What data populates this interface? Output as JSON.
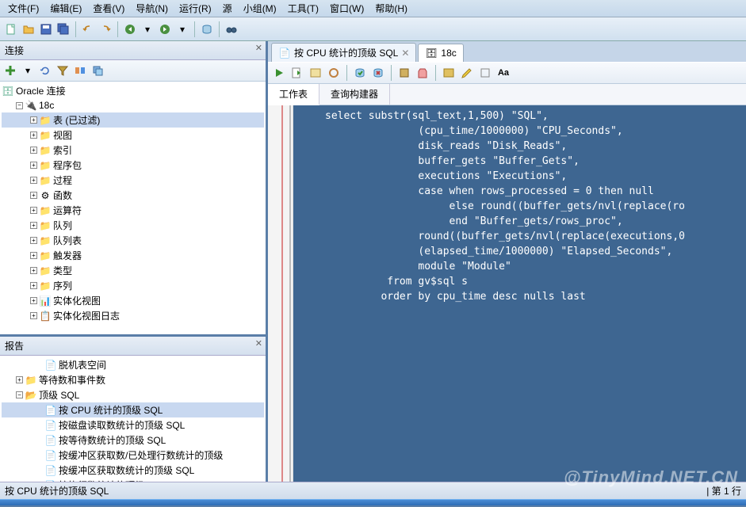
{
  "menu": [
    "文件(F)",
    "编辑(E)",
    "查看(V)",
    "导航(N)",
    "运行(R)",
    "源",
    "小组(M)",
    "工具(T)",
    "窗口(W)",
    "帮助(H)"
  ],
  "left": {
    "conn_title": "连接",
    "root": "Oracle 连接",
    "db": "18c",
    "nodes": [
      "表 (已过滤)",
      "视图",
      "索引",
      "程序包",
      "过程",
      "函数",
      "运算符",
      "队列",
      "队列表",
      "触发器",
      "类型",
      "序列",
      "实体化视图",
      "实体化视图日志"
    ],
    "reports_title": "报告",
    "reports": {
      "n0": "脱机表空间",
      "n1": "等待数和事件数",
      "n2": "顶级 SQL",
      "children": [
        "按 CPU 统计的顶级 SQL",
        "按磁盘读取数统计的顶级 SQL",
        "按等待数统计的顶级 SQL",
        "按缓冲区获取数/已处理行数统计的顶级",
        "按缓冲区获取数统计的顶级 SQL",
        "按执行数统计的顶级 SQL"
      ]
    }
  },
  "tabs": {
    "t1": "按 CPU 统计的顶级 SQL",
    "t2": "18c"
  },
  "subtabs": {
    "worksheet": "工作表",
    "qb": "查询构建器"
  },
  "sql": "select substr(sql_text,1,500) \"SQL\",\n               (cpu_time/1000000) \"CPU_Seconds\",\n               disk_reads \"Disk_Reads\",\n               buffer_gets \"Buffer_Gets\",\n               executions \"Executions\",\n               case when rows_processed = 0 then null\n                    else round((buffer_gets/nvl(replace(ro\n                    end \"Buffer_gets/rows_proc\",\n               round((buffer_gets/nvl(replace(executions,0\n               (elapsed_time/1000000) \"Elapsed_Seconds\",\n               module \"Module\"\n          from gv$sql s\n         order by cpu_time desc nulls last",
  "status": "按 CPU 统计的顶级 SQL",
  "status_right": "| 第 1 行",
  "watermark": "@TinyMind.NET.CN"
}
